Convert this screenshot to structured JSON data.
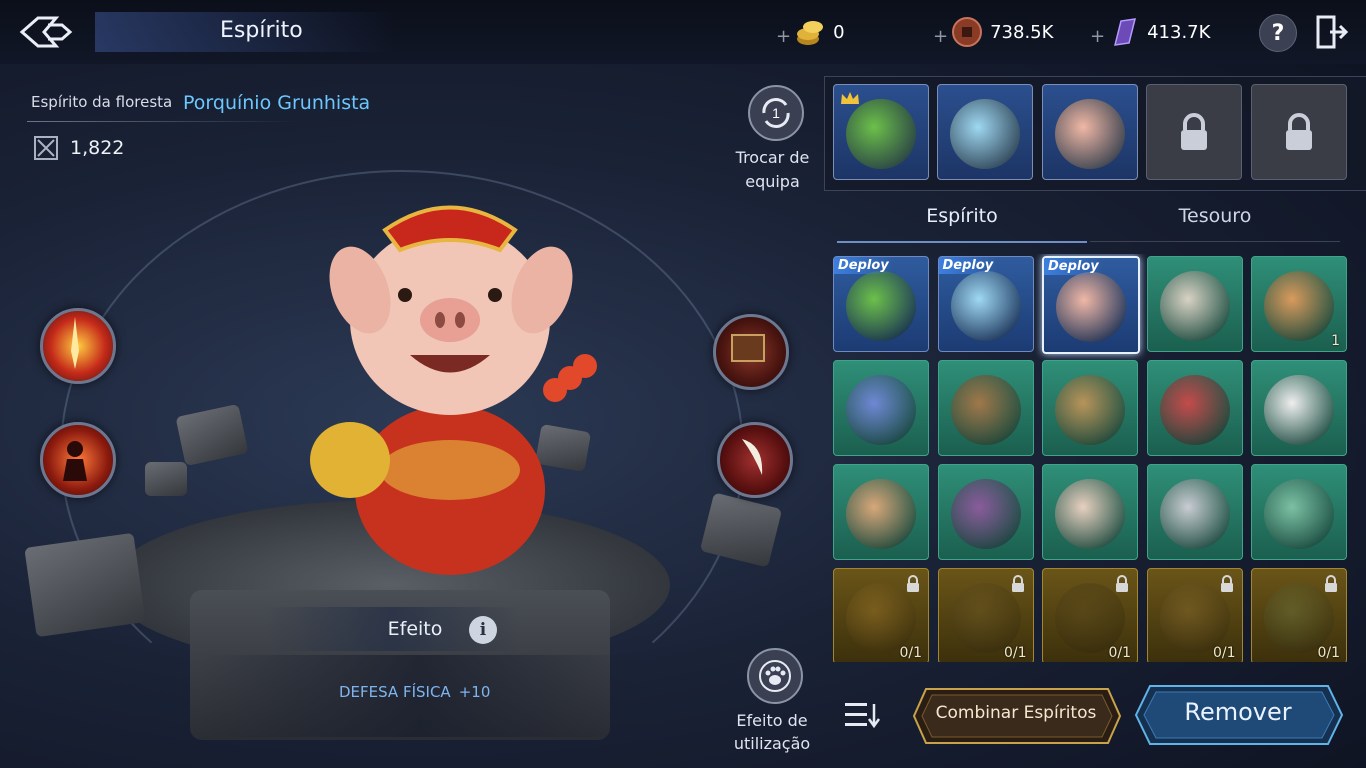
{
  "header": {
    "title": "Espírito",
    "currencies": [
      {
        "icon": "gold-coin-stack-icon",
        "value": "0"
      },
      {
        "icon": "bronze-coin-icon",
        "value": "738.5K"
      },
      {
        "icon": "purple-crystal-icon",
        "value": "413.7K"
      }
    ],
    "add_symbol": "+",
    "help_symbol": "?"
  },
  "spirit": {
    "type_label": "Espírito da floresta",
    "name": "Porquínio Grunhista",
    "power": "1,822"
  },
  "actions": {
    "team_swap_badge": "1",
    "team_swap_label": "Trocar de equipa",
    "use_effect_label": "Efeito de utilização"
  },
  "effect": {
    "title": "Efeito",
    "info_symbol": "i",
    "stat_name": "DEFESA FÍSICA",
    "stat_value": "+10"
  },
  "team_slots": [
    {
      "state": "filled",
      "spirit": "green-dragon",
      "leader": true
    },
    {
      "state": "filled",
      "spirit": "blue-bird",
      "leader": false
    },
    {
      "state": "filled",
      "spirit": "pig",
      "leader": false
    },
    {
      "state": "locked"
    },
    {
      "state": "locked"
    }
  ],
  "tabs": [
    "Espírito",
    "Tesouro"
  ],
  "deploy_label": "Deploy",
  "grid": [
    {
      "bg": "blue",
      "deploy": true,
      "spirit": "green-dragon",
      "color": "#6cc04a"
    },
    {
      "bg": "blue",
      "deploy": true,
      "spirit": "blue-bird",
      "color": "#9fd8f2"
    },
    {
      "bg": "blue",
      "deploy": true,
      "spirit": "pig",
      "color": "#f0b8a6",
      "selected": true
    },
    {
      "bg": "green",
      "spirit": "dog-warrior",
      "color": "#d9d2c4"
    },
    {
      "bg": "green",
      "spirit": "monkey",
      "color": "#d99a5c",
      "count": "1"
    },
    {
      "bg": "green",
      "spirit": "blue-ogre",
      "color": "#6f88d4"
    },
    {
      "bg": "green",
      "spirit": "bear",
      "color": "#a0784a"
    },
    {
      "bg": "green",
      "spirit": "owl",
      "color": "#b8945a"
    },
    {
      "bg": "green",
      "spirit": "opera-mask",
      "color": "#c44b4b"
    },
    {
      "bg": "green",
      "spirit": "white-cat",
      "color": "#eeeeee"
    },
    {
      "bg": "green",
      "spirit": "cow",
      "color": "#d8a77a"
    },
    {
      "bg": "green",
      "spirit": "purple-dragon",
      "color": "#8a5c9c"
    },
    {
      "bg": "green",
      "spirit": "rabbit",
      "color": "#e8d0c0"
    },
    {
      "bg": "green",
      "spirit": "lion-dancer",
      "color": "#c9ccd2"
    },
    {
      "bg": "green",
      "spirit": "lizard",
      "color": "#7cc0a4"
    },
    {
      "bg": "gold",
      "spirit": "phoenix",
      "color": "#a37a2a",
      "locked": true,
      "count": "0/1"
    },
    {
      "bg": "gold",
      "spirit": "eagle",
      "color": "#6f5a26",
      "locked": true,
      "count": "0/1"
    },
    {
      "bg": "gold",
      "spirit": "panther",
      "color": "#5b4a1e",
      "locked": true,
      "count": "0/1"
    },
    {
      "bg": "gold",
      "spirit": "qilin",
      "color": "#8e6f30",
      "locked": true,
      "count": "0/1"
    },
    {
      "bg": "gold",
      "spirit": "jade-beast",
      "color": "#6f7a42",
      "locked": true,
      "count": "0/1"
    }
  ],
  "buttons": {
    "combine": "Combinar Espíritos",
    "remove": "Remover"
  },
  "colors": {
    "accent_blue": "#6cc7ff",
    "stat_blue": "#7fb5ee",
    "gold": "#c9a24a"
  }
}
